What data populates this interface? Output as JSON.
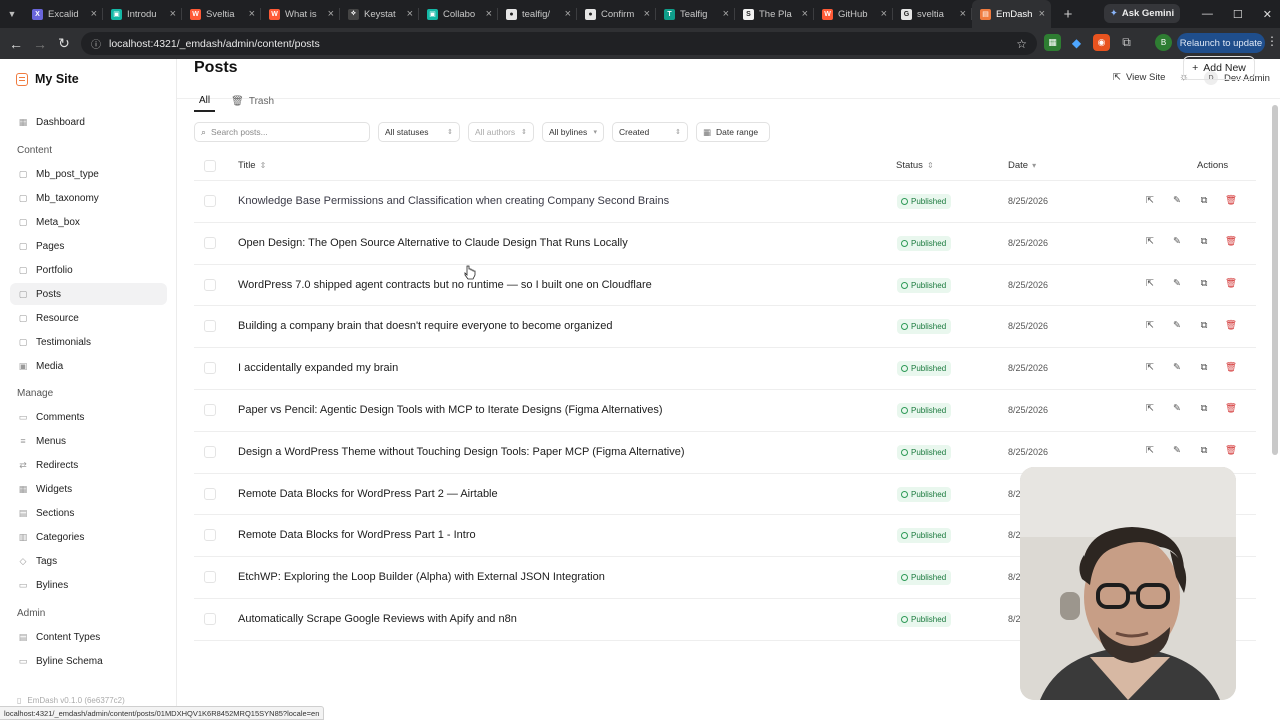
{
  "browser": {
    "tabs": [
      {
        "label": "Excalid",
        "fav": "X",
        "color": "#6965db"
      },
      {
        "label": "Introdu",
        "fav": "▣",
        "color": "#14b8a6"
      },
      {
        "label": "Sveltia",
        "fav": "W",
        "color": "#ff5a36"
      },
      {
        "label": "What is",
        "fav": "W",
        "color": "#ff5a36"
      },
      {
        "label": "Keystat",
        "fav": "⟡",
        "color": "#444"
      },
      {
        "label": "Collabo",
        "fav": "▣",
        "color": "#14b8a6"
      },
      {
        "label": "tealfig/",
        "fav": "●",
        "color": "#e6e6e6"
      },
      {
        "label": "Confirm",
        "fav": "●",
        "color": "#e6e6e6"
      },
      {
        "label": "Tealfig",
        "fav": "T",
        "color": "#0f9d8a"
      },
      {
        "label": "The Pla",
        "fav": "S",
        "color": "#f2f2f2"
      },
      {
        "label": "GitHub",
        "fav": "W",
        "color": "#ff5a36"
      },
      {
        "label": "sveltia",
        "fav": "G",
        "color": "#e6e6e6"
      },
      {
        "label": "EmDash",
        "fav": "▤",
        "color": "#f07b3f"
      }
    ],
    "ask_gemini": "Ask Gemini",
    "url": "localhost:4321/_emdash/admin/content/posts",
    "relaunch": "Relaunch to update",
    "status_url": "localhost:4321/_emdash/admin/content/posts/01MDXHQV1K6R8452MRQ15SYN85?locale=en"
  },
  "sidebar": {
    "brand": "My Site",
    "top": [
      {
        "label": "Dashboard",
        "icon": "▦"
      }
    ],
    "content_heading": "Content",
    "content": [
      {
        "label": "Mb_post_type",
        "icon": "▢"
      },
      {
        "label": "Mb_taxonomy",
        "icon": "▢"
      },
      {
        "label": "Meta_box",
        "icon": "▢"
      },
      {
        "label": "Pages",
        "icon": "▢"
      },
      {
        "label": "Portfolio",
        "icon": "▢"
      },
      {
        "label": "Posts",
        "icon": "▢",
        "active": true
      },
      {
        "label": "Resource",
        "icon": "▢"
      },
      {
        "label": "Testimonials",
        "icon": "▢"
      },
      {
        "label": "Media",
        "icon": "▣"
      }
    ],
    "manage_heading": "Manage",
    "manage": [
      {
        "label": "Comments",
        "icon": "▭"
      },
      {
        "label": "Menus",
        "icon": "≡"
      },
      {
        "label": "Redirects",
        "icon": "⇄"
      },
      {
        "label": "Widgets",
        "icon": "▦"
      },
      {
        "label": "Sections",
        "icon": "▤"
      },
      {
        "label": "Categories",
        "icon": "▥"
      },
      {
        "label": "Tags",
        "icon": "◇"
      },
      {
        "label": "Bylines",
        "icon": "▭"
      }
    ],
    "admin_heading": "Admin",
    "admin": [
      {
        "label": "Content Types",
        "icon": "▤"
      },
      {
        "label": "Byline Schema",
        "icon": "▭"
      }
    ],
    "footer": "EmDash v0.1.0 (6e6377c2)"
  },
  "topbar": {
    "view_site": "View Site",
    "user_initial": "D",
    "user_name": "Dev Admin"
  },
  "main": {
    "title": "Posts",
    "add_new": "Add New",
    "tabs": [
      "All",
      "Trash"
    ],
    "search_placeholder": "Search posts...",
    "filters": [
      "All statuses",
      "All authors",
      "All bylines",
      "Created",
      "Date range"
    ],
    "columns": {
      "title": "Title",
      "status": "Status",
      "date": "Date",
      "actions": "Actions"
    },
    "rows": [
      {
        "title": "Knowledge Base Permissions and Classification when creating Company Second Brains",
        "status": "Published",
        "date": "8/25/2026"
      },
      {
        "title": "Open Design: The Open Source Alternative to Claude Design That Runs Locally",
        "status": "Published",
        "date": "8/25/2026"
      },
      {
        "title": "WordPress 7.0 shipped agent contracts but no runtime — so I built one on Cloudflare",
        "status": "Published",
        "date": "8/25/2026"
      },
      {
        "title": "Building a company brain that doesn't require everyone to become organized",
        "status": "Published",
        "date": "8/25/2026"
      },
      {
        "title": "I accidentally expanded my brain",
        "status": "Published",
        "date": "8/25/2026"
      },
      {
        "title": "Paper vs Pencil: Agentic Design Tools with MCP to Iterate Designs (Figma Alternatives)",
        "status": "Published",
        "date": "8/25/2026"
      },
      {
        "title": "Design a WordPress Theme without Touching Design Tools: Paper MCP (Figma Alternative)",
        "status": "Published",
        "date": "8/25/2026"
      },
      {
        "title": "Remote Data Blocks for WordPress Part 2 — Airtable",
        "status": "Published",
        "date": "8/25/2026"
      },
      {
        "title": "Remote Data Blocks for WordPress Part 1 - Intro",
        "status": "Published",
        "date": "8/25/2026"
      },
      {
        "title": "EtchWP: Exploring the Loop Builder (Alpha) with External JSON Integration",
        "status": "Published",
        "date": "8/25/2026"
      },
      {
        "title": "Automatically Scrape Google Reviews with Apify and n8n",
        "status": "Published",
        "date": "8/25/2026"
      }
    ]
  },
  "colors": {
    "accent": "#f07b3f",
    "published_bg": "#e9f7ee",
    "published_fg": "#1b7a3e",
    "delete": "#d43c3c"
  }
}
